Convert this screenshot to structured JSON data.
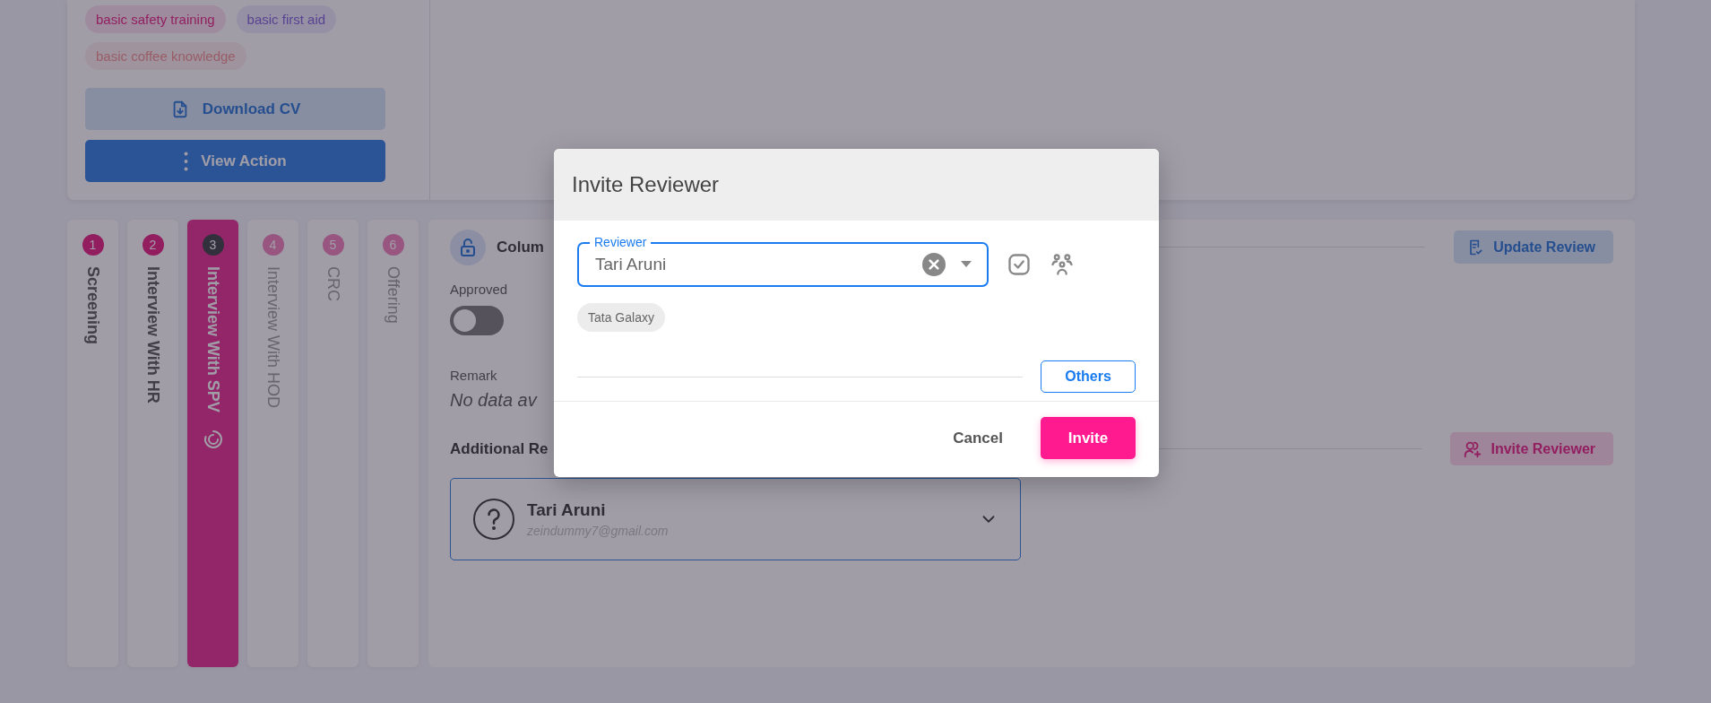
{
  "profile": {
    "skills": [
      {
        "label": "basic safety training",
        "color": "#921f61"
      },
      {
        "label": "basic first aid",
        "color": "#584392"
      },
      {
        "label": "basic coffee knowledge",
        "color": "#985d67"
      }
    ],
    "buttons": [
      {
        "kind": "download",
        "label": "Download CV"
      },
      {
        "kind": "menu",
        "label": "View Action"
      }
    ]
  },
  "stages": [
    {
      "number": "1",
      "label": "Screening",
      "completed": true,
      "selected": false
    },
    {
      "number": "2",
      "label": "Interview With HR",
      "completed": true,
      "selected": false
    },
    {
      "number": "3",
      "label": "Interview With SPV",
      "completed": false,
      "selected": true
    },
    {
      "number": "4",
      "label": "Interview With HOD",
      "completed": false,
      "selected": false
    },
    {
      "number": "5",
      "label": "CRC",
      "completed": false,
      "selected": false
    },
    {
      "number": "6",
      "label": "Offering",
      "completed": false,
      "selected": false
    }
  ],
  "review": {
    "title": "Colum",
    "approved_label": "Approved",
    "approved": false,
    "remark_label": "Remark",
    "remark": "No data av",
    "additional_title": "Additional Re",
    "update_button": "Update Review",
    "invite_button": "Invite Reviewer",
    "reviewers": [
      {
        "name": "Tari Aruni",
        "email": "zeindummy7@gmail.com",
        "expanded": false
      }
    ]
  },
  "dialog": {
    "title": "Invite Reviewer",
    "field": {
      "label": "Reviewer",
      "value": "Tari Aruni"
    },
    "chips": [
      "Tata Galaxy"
    ],
    "others_button": "Others",
    "cancel_button": "Cancel",
    "invite_button": "Invite"
  }
}
